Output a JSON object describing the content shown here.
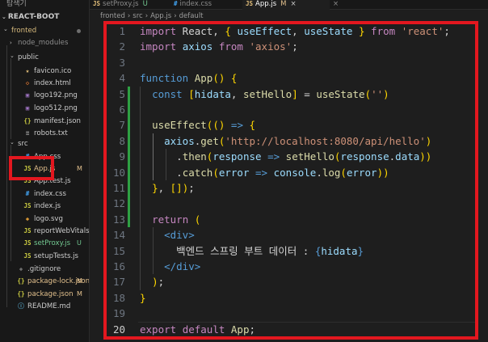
{
  "sidebar": {
    "title": "탐색기",
    "header": "REACT-BOOT",
    "items": [
      {
        "label": "fronted",
        "kind": "folder-open",
        "icon": "chevron-down",
        "color": "#d7ba7d",
        "badge": "dot"
      },
      {
        "label": "node_modules",
        "kind": "folder",
        "icon": "chevron-right",
        "color": "#8c8c8c"
      },
      {
        "label": "public",
        "kind": "folder-open",
        "icon": "chevron-down",
        "color": "#cccccc"
      },
      {
        "label": "favicon.ico",
        "kind": "file",
        "icon": "star-icon",
        "glyph": "★",
        "iconColor": "#e5c07b",
        "color": "#cccccc"
      },
      {
        "label": "index.html",
        "kind": "file",
        "icon": "html-icon",
        "glyph": "◇",
        "iconColor": "#e37933",
        "color": "#cccccc"
      },
      {
        "label": "logo192.png",
        "kind": "file",
        "icon": "image-icon",
        "glyph": "▣",
        "iconColor": "#a074c4",
        "color": "#cccccc"
      },
      {
        "label": "logo512.png",
        "kind": "file",
        "icon": "image-icon",
        "glyph": "▣",
        "iconColor": "#a074c4",
        "color": "#cccccc"
      },
      {
        "label": "manifest.json",
        "kind": "file",
        "icon": "json-icon",
        "glyph": "{}",
        "iconColor": "#cbcb41",
        "color": "#cccccc"
      },
      {
        "label": "robots.txt",
        "kind": "file",
        "icon": "text-file-icon",
        "glyph": "≡",
        "iconColor": "#9d9d9d",
        "color": "#cccccc"
      },
      {
        "label": "src",
        "kind": "folder-open",
        "icon": "chevron-down",
        "color": "#cccccc"
      },
      {
        "label": "App.css",
        "kind": "file",
        "icon": "css-icon",
        "glyph": "#",
        "iconColor": "#42a5f5",
        "color": "#cccccc"
      },
      {
        "label": "App.js",
        "kind": "file",
        "icon": "js-icon",
        "glyph": "JS",
        "iconColor": "#cbcb41",
        "color": "#e2c08d",
        "badge": "M",
        "badgeColor": "#e2c08d",
        "selected": true
      },
      {
        "label": "App.test.js",
        "kind": "file",
        "icon": "js-icon",
        "glyph": "JS",
        "iconColor": "#cbcb41",
        "color": "#cccccc"
      },
      {
        "label": "index.css",
        "kind": "file",
        "icon": "css-icon",
        "glyph": "#",
        "iconColor": "#42a5f5",
        "color": "#cccccc"
      },
      {
        "label": "index.js",
        "kind": "file",
        "icon": "js-icon",
        "glyph": "JS",
        "iconColor": "#cbcb41",
        "color": "#cccccc"
      },
      {
        "label": "logo.svg",
        "kind": "file",
        "icon": "svg-icon",
        "glyph": "◈",
        "iconColor": "#ffb13b",
        "color": "#cccccc"
      },
      {
        "label": "reportWebVitals.js",
        "kind": "file",
        "icon": "js-icon",
        "glyph": "JS",
        "iconColor": "#cbcb41",
        "color": "#cccccc"
      },
      {
        "label": "setProxy.js",
        "kind": "file",
        "icon": "js-icon",
        "glyph": "JS",
        "iconColor": "#cbcb41",
        "color": "#73c991",
        "badge": "U",
        "badgeColor": "#73c991"
      },
      {
        "label": "setupTests.js",
        "kind": "file",
        "icon": "js-icon",
        "glyph": "JS",
        "iconColor": "#cbcb41",
        "color": "#cccccc"
      },
      {
        "label": ".gitignore",
        "kind": "file",
        "icon": "git-icon",
        "glyph": "◆",
        "iconColor": "#6e6e6e",
        "color": "#cccccc"
      },
      {
        "label": "package-lock.json",
        "kind": "file",
        "icon": "json-icon",
        "glyph": "{}",
        "iconColor": "#cbcb41",
        "color": "#e2c08d",
        "badge": "M",
        "badgeColor": "#e2c08d"
      },
      {
        "label": "package.json",
        "kind": "file",
        "icon": "json-icon",
        "glyph": "{}",
        "iconColor": "#cbcb41",
        "color": "#e2c08d",
        "badge": "M",
        "badgeColor": "#e2c08d"
      },
      {
        "label": "README.md",
        "kind": "file",
        "icon": "info-icon",
        "glyph": "ⓘ",
        "iconColor": "#519aba",
        "color": "#cccccc"
      }
    ]
  },
  "tabs": [
    {
      "label": "setProxy.js",
      "icon": "JS",
      "badge": "U",
      "active": false
    },
    {
      "label": "index.css",
      "icon": "#",
      "badge": "",
      "active": false
    },
    {
      "label": "App.js",
      "icon": "JS",
      "badge": "M",
      "active": true
    },
    {
      "label": "close",
      "icon": "×",
      "badge": "",
      "active": false
    }
  ],
  "breadcrumb": [
    "fronted",
    "src",
    "App.js",
    "default"
  ],
  "editor": {
    "current_line": 20,
    "lines": [
      [
        [
          "kw",
          "import"
        ],
        [
          "txt",
          " React, "
        ],
        [
          "pun",
          "{"
        ],
        [
          "txt",
          " "
        ],
        [
          "var",
          "useEffect"
        ],
        [
          "txt",
          ", "
        ],
        [
          "var",
          "useState"
        ],
        [
          "txt",
          " "
        ],
        [
          "pun",
          "}"
        ],
        [
          "txt",
          " "
        ],
        [
          "kw",
          "from"
        ],
        [
          "txt",
          " "
        ],
        [
          "str",
          "'react'"
        ],
        [
          "txt",
          ";"
        ]
      ],
      [
        [
          "kw",
          "import"
        ],
        [
          "txt",
          " "
        ],
        [
          "var",
          "axios"
        ],
        [
          "txt",
          " "
        ],
        [
          "kw",
          "from"
        ],
        [
          "txt",
          " "
        ],
        [
          "str",
          "'axios'"
        ],
        [
          "txt",
          ";"
        ]
      ],
      [],
      [
        [
          "kwb",
          "function"
        ],
        [
          "txt",
          " "
        ],
        [
          "fn",
          "App"
        ],
        [
          "pun",
          "()"
        ],
        [
          "txt",
          " "
        ],
        [
          "pun",
          "{"
        ]
      ],
      [
        [
          "txt",
          "  "
        ],
        [
          "kwb",
          "const"
        ],
        [
          "txt",
          " "
        ],
        [
          "pun",
          "["
        ],
        [
          "var",
          "hidata"
        ],
        [
          "txt",
          ", "
        ],
        [
          "fn",
          "setHello"
        ],
        [
          "pun",
          "]"
        ],
        [
          "txt",
          " = "
        ],
        [
          "fn",
          "useState"
        ],
        [
          "pun",
          "("
        ],
        [
          "str",
          "''"
        ],
        [
          "pun",
          ")"
        ]
      ],
      [],
      [
        [
          "txt",
          "  "
        ],
        [
          "fn",
          "useEffect"
        ],
        [
          "pun",
          "("
        ],
        [
          "pun",
          "()"
        ],
        [
          "txt",
          " "
        ],
        [
          "kwb",
          "=>"
        ],
        [
          "txt",
          " "
        ],
        [
          "pun",
          "{"
        ]
      ],
      [
        [
          "txt",
          "    "
        ],
        [
          "var",
          "axios"
        ],
        [
          "txt",
          "."
        ],
        [
          "fn",
          "get"
        ],
        [
          "pun",
          "("
        ],
        [
          "str",
          "'http://localhost:8080/api/hello'"
        ],
        [
          "pun",
          ")"
        ]
      ],
      [
        [
          "txt",
          "      ."
        ],
        [
          "fn",
          "then"
        ],
        [
          "pun",
          "("
        ],
        [
          "var",
          "response"
        ],
        [
          "txt",
          " "
        ],
        [
          "kwb",
          "=>"
        ],
        [
          "txt",
          " "
        ],
        [
          "fn",
          "setHello"
        ],
        [
          "pun",
          "("
        ],
        [
          "var",
          "response"
        ],
        [
          "txt",
          "."
        ],
        [
          "var",
          "data"
        ],
        [
          "pun",
          "))"
        ]
      ],
      [
        [
          "txt",
          "      ."
        ],
        [
          "fn",
          "catch"
        ],
        [
          "pun",
          "("
        ],
        [
          "var",
          "error"
        ],
        [
          "txt",
          " "
        ],
        [
          "kwb",
          "=>"
        ],
        [
          "txt",
          " "
        ],
        [
          "var",
          "console"
        ],
        [
          "txt",
          "."
        ],
        [
          "fn",
          "log"
        ],
        [
          "pun",
          "("
        ],
        [
          "var",
          "error"
        ],
        [
          "pun",
          "))"
        ]
      ],
      [
        [
          "txt",
          "  "
        ],
        [
          "pun",
          "}"
        ],
        [
          "txt",
          ", "
        ],
        [
          "pun",
          "[]"
        ],
        [
          "pun",
          ")"
        ],
        [
          "txt",
          ";"
        ]
      ],
      [],
      [
        [
          "txt",
          "  "
        ],
        [
          "kw",
          "return"
        ],
        [
          "txt",
          " "
        ],
        [
          "pun",
          "("
        ]
      ],
      [
        [
          "txt",
          "    "
        ],
        [
          "tag",
          "<div>"
        ]
      ],
      [
        [
          "txt",
          "      백엔드 스프링 부트 데이터 : "
        ],
        [
          "kwb",
          "{"
        ],
        [
          "var",
          "hidata"
        ],
        [
          "kwb",
          "}"
        ]
      ],
      [
        [
          "txt",
          "    "
        ],
        [
          "tag",
          "</div>"
        ]
      ],
      [
        [
          "txt",
          "  "
        ],
        [
          "pun",
          ")"
        ],
        [
          "txt",
          ";"
        ]
      ],
      [
        [
          "pun",
          "}"
        ]
      ],
      [],
      [
        [
          "kw",
          "export"
        ],
        [
          "txt",
          " "
        ],
        [
          "kw",
          "default"
        ],
        [
          "txt",
          " "
        ],
        [
          "fn",
          "App"
        ],
        [
          "txt",
          ";"
        ]
      ]
    ]
  },
  "colors": {
    "annotation_red": "#e3171f",
    "modified": "#e2c08d",
    "untracked": "#73c991",
    "git_added": "#2ea043"
  }
}
